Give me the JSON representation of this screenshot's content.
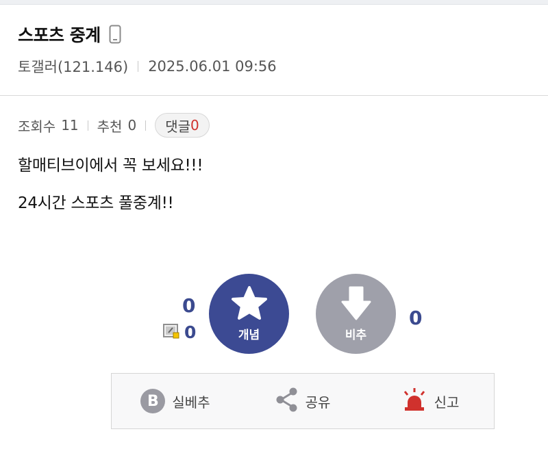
{
  "post": {
    "title": "스포츠 중계",
    "author": "토갤러(121.146)",
    "datetime": "2025.06.01 09:56",
    "device_icon": "mobile-phone-icon"
  },
  "stats": {
    "views_label": "조회수",
    "views": "11",
    "recommend_label": "추천",
    "recommend": "0",
    "comments_label": "댓글",
    "comments": "0"
  },
  "body": {
    "lines": [
      "할매티브이에서 꼭 보세요!!!",
      "24시간 스포츠 풀중계!!"
    ]
  },
  "vote": {
    "up_count": "0",
    "memo_count": "0",
    "up_label": "개념",
    "down_label": "비추",
    "down_count": "0",
    "up_color": "#3c4a93",
    "down_color": "#9fa0aa"
  },
  "actions": {
    "best_label": "실베추",
    "best_icon_letter": "B",
    "share_label": "공유",
    "report_label": "신고",
    "report_color": "#d0312d"
  }
}
